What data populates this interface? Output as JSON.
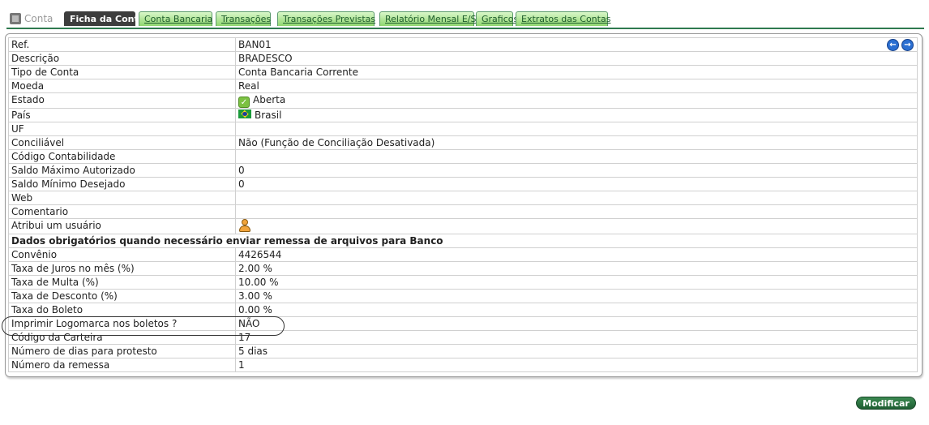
{
  "tabs": {
    "home_label": "Conta",
    "items": [
      {
        "label": "Ficha da Conta",
        "active": true
      },
      {
        "label": "Conta Bancaria"
      },
      {
        "label": "Transações"
      },
      {
        "label": "Transações Previstas"
      },
      {
        "label": "Relatório Mensal E/S"
      },
      {
        "label": "Graficos"
      },
      {
        "label": "Extratos das Contas"
      }
    ]
  },
  "fields": [
    {
      "label": "Ref.",
      "value": "BAN01"
    },
    {
      "label": "Descrição",
      "value": "BRADESCO"
    },
    {
      "label": "Tipo de Conta",
      "value": "Conta Bancaria Corrente"
    },
    {
      "label": "Moeda",
      "value": "Real"
    },
    {
      "label": "Estado",
      "value": "Aberta",
      "icon": "green-check-icon"
    },
    {
      "label": "País",
      "value": "Brasil",
      "icon": "brazil-flag-icon"
    },
    {
      "label": "UF",
      "value": ""
    },
    {
      "label": "Conciliável",
      "value": "Não (Função de Conciliação Desativada)"
    },
    {
      "label": "Código Contabilidade",
      "value": ""
    },
    {
      "label": "Saldo Máximo Autorizado",
      "value": "0"
    },
    {
      "label": "Saldo Mínimo Desejado",
      "value": "0"
    },
    {
      "label": "Web",
      "value": ""
    },
    {
      "label": "Comentario",
      "value": ""
    },
    {
      "label": "Atribui um usuário",
      "value": "",
      "icon": "user-icon"
    }
  ],
  "section_title": "Dados obrigatórios quando necessário enviar remessa de arquivos para Banco",
  "bank_fields": [
    {
      "label": "Convênio",
      "value": "4426544"
    },
    {
      "label": "Taxa de Juros no mês (%)",
      "value": "2.00 %"
    },
    {
      "label": "Taxa de Multa (%)",
      "value": "10.00 %"
    },
    {
      "label": "Taxa de Desconto (%)",
      "value": "3.00 %"
    },
    {
      "label": "Taxa do Boleto",
      "value": "0.00 %"
    },
    {
      "label": "Imprimir Logomarca nos boletos ?",
      "value": "NÃO"
    },
    {
      "label": "Código da Carteira",
      "value": "17"
    },
    {
      "label": "Número de dias para protesto",
      "value": "5 dias"
    },
    {
      "label": "Número da remessa",
      "value": "1"
    }
  ],
  "nav": {
    "prev_icon": "arrow-left-icon",
    "next_icon": "arrow-right-icon"
  },
  "actions": {
    "modify_label": "Modificar"
  },
  "colors": {
    "tab_active": "#3d3d3d",
    "tab_green": "#8fd66f",
    "accent": "#2f7a4f",
    "button": "#1f5e33"
  }
}
